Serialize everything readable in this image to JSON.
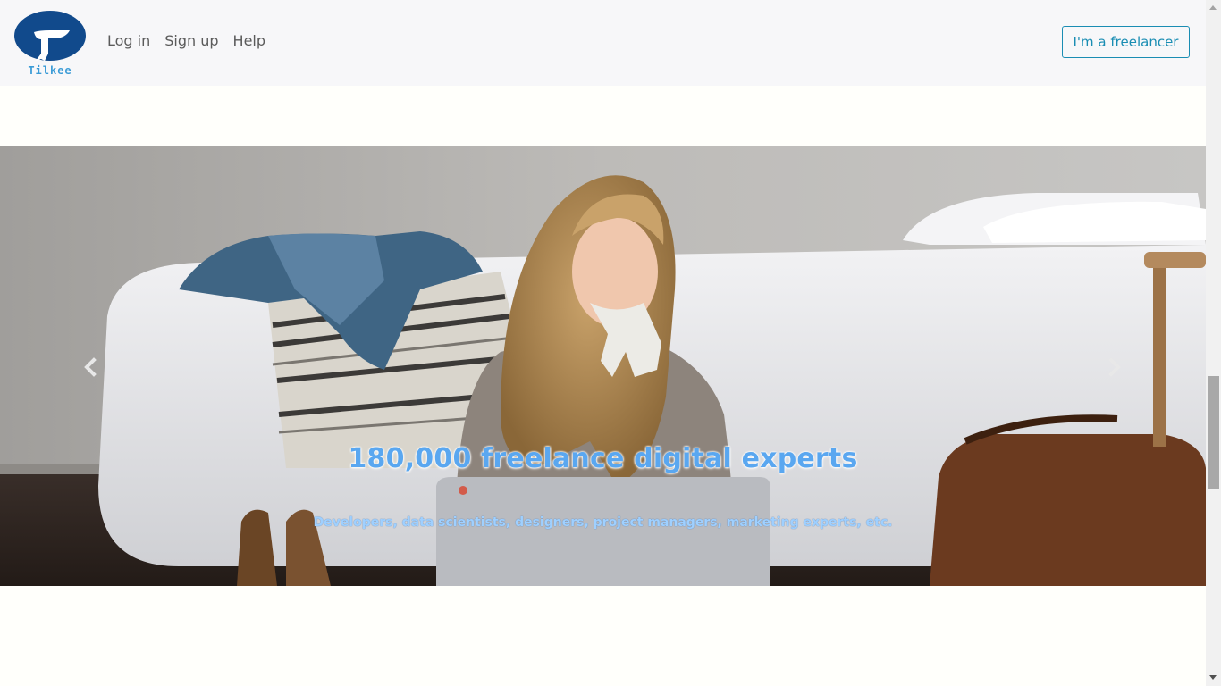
{
  "brand": {
    "logo_text": "Tilkee",
    "logo_color": "#114a8c"
  },
  "nav": {
    "items": [
      {
        "label": "Log in"
      },
      {
        "label": "Sign up"
      },
      {
        "label": "Help"
      }
    ]
  },
  "header": {
    "cta_label": "I'm a freelancer",
    "cta_color": "#1a8db3"
  },
  "carousel": {
    "title": "180,000 freelance digital experts",
    "subtitle": "Developers, data scientists, designers, project managers, marketing experts, etc.",
    "prev_icon": "chevron-left-icon",
    "next_icon": "chevron-right-icon",
    "title_color": "#5aa7f0"
  }
}
